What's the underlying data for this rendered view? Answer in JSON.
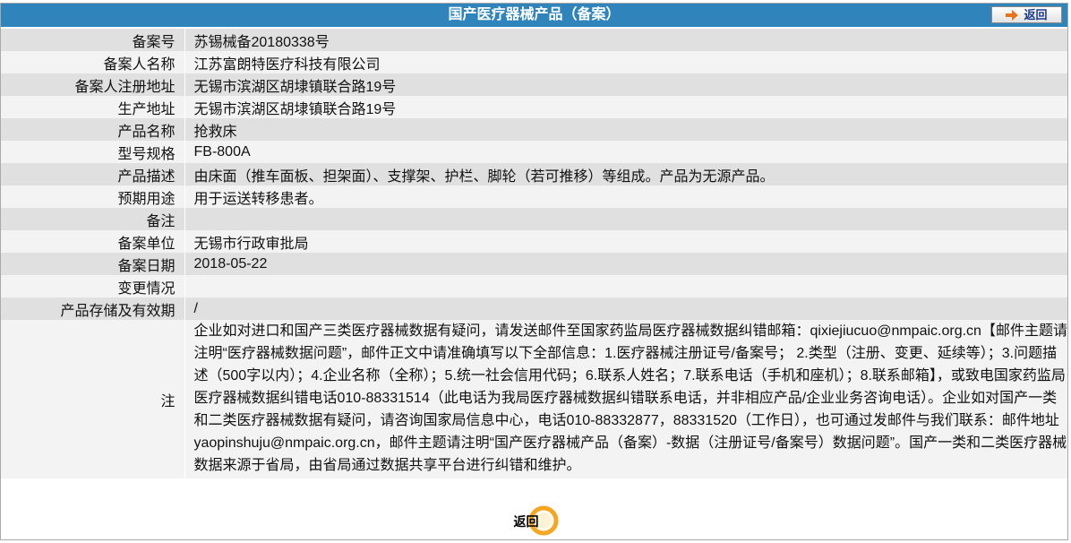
{
  "header": {
    "title": "国产医疗器械产品（备案）",
    "back_label": "返回"
  },
  "rows": [
    {
      "label": "备案号",
      "value": "苏锡械备20180338号"
    },
    {
      "label": "备案人名称",
      "value": "江苏富朗特医疗科技有限公司"
    },
    {
      "label": "备案人注册地址",
      "value": "无锡市滨湖区胡埭镇联合路19号"
    },
    {
      "label": "生产地址",
      "value": "无锡市滨湖区胡埭镇联合路19号"
    },
    {
      "label": "产品名称",
      "value": "抢救床"
    },
    {
      "label": "型号规格",
      "value": "FB-800A"
    },
    {
      "label": "产品描述",
      "value": "由床面（推车面板、担架面）、支撑架、护栏、脚轮（若可推移）等组成。产品为无源产品。"
    },
    {
      "label": "预期用途",
      "value": "用于运送转移患者。"
    },
    {
      "label": "备注",
      "value": ""
    },
    {
      "label": "备案单位",
      "value": "无锡市行政审批局"
    },
    {
      "label": "备案日期",
      "value": "2018-05-22"
    },
    {
      "label": "变更情况",
      "value": ""
    },
    {
      "label": "产品存储及有效期",
      "value": "/"
    }
  ],
  "note": {
    "label": "注",
    "text": "企业如对进口和国产三类医疗器械数据有疑问，请发送邮件至国家药监局医疗器械数据纠错邮箱：qixiejiucuo@nmpaic.org.cn【邮件主题请注明“医疗器械数据问题”，邮件正文中请准确填写以下全部信息：1.医疗器械注册证号/备案号； 2.类型（注册、变更、延续等）；3.问题描述（500字以内）；4.企业名称（全称）；5.统一社会信用代码；6.联系人姓名；7.联系电话（手机和座机）；8.联系邮箱】，或致电国家药监局医疗器械数据纠错电话010-88331514（此电话为我局医疗器械数据纠错联系电话，并非相应产品/企业业务咨询电话）。企业如对国产一类和二类医疗器械数据有疑问，请咨询国家局信息中心，电话010-88332877，88331520（工作日），也可通过发邮件与我们联系：邮件地址yaopinshuju@nmpaic.org.cn，邮件主题请注明“国产医疗器械产品（备案）-数据（注册证号/备案号）数据问题”。国产一类和二类医疗器械数据来源于省局，由省局通过数据共享平台进行纠错和维护。"
  },
  "footer": {
    "back_label": "返回"
  },
  "colors": {
    "header_bg": "#2f84bb",
    "row_odd": "#e0e0e0",
    "row_even": "#f3f3f3",
    "accent_orange": "#f5a623"
  },
  "icons": {
    "back_top": "arrow-right-icon",
    "back_bottom": "orange-ring-icon"
  }
}
